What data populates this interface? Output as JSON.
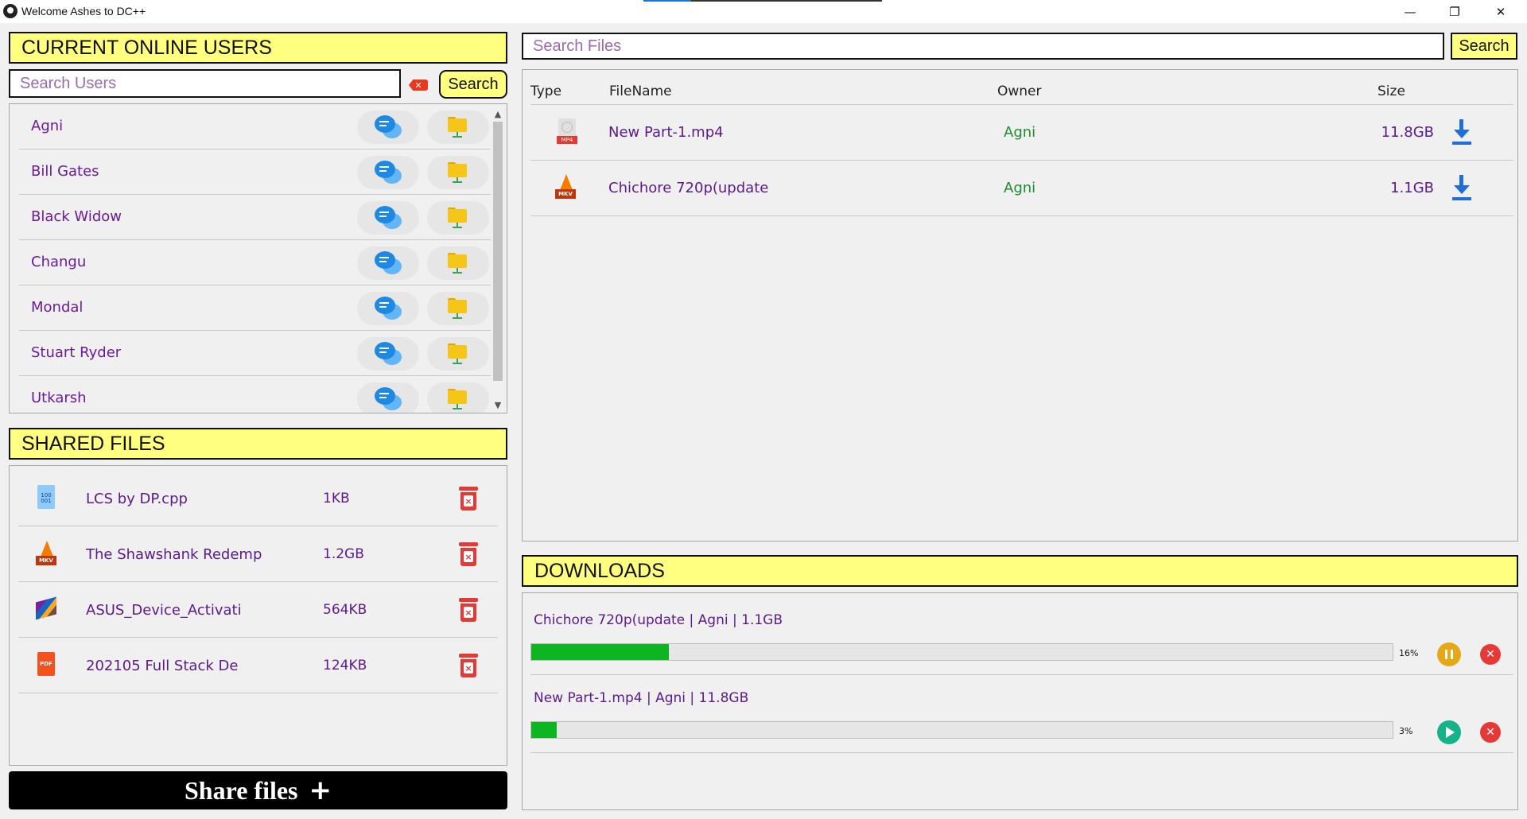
{
  "window": {
    "title": "Welcome Ashes to DC++",
    "minimize_glyph": "—",
    "restore_glyph": "❐",
    "close_glyph": "✕"
  },
  "users": {
    "header": "CURRENT ONLINE USERS",
    "search_placeholder": "Search Users",
    "clear_glyph": "✕",
    "search_button": "Search",
    "list": [
      {
        "name": "Agni"
      },
      {
        "name": "Bill Gates"
      },
      {
        "name": "Black Widow"
      },
      {
        "name": "Changu"
      },
      {
        "name": "Mondal"
      },
      {
        "name": "Stuart Ryder"
      },
      {
        "name": "Utkarsh"
      }
    ]
  },
  "shared": {
    "header": "SHARED FILES",
    "files": [
      {
        "name": "LCS by DP.cpp",
        "size": "1KB",
        "icon": "binary-file-icon",
        "badge": "100\n001"
      },
      {
        "name": "The Shawshank Redemp",
        "size": "1.2GB",
        "icon": "mkv-file-icon",
        "badge": "MKV"
      },
      {
        "name": "ASUS_Device_Activati",
        "size": "564KB",
        "icon": "archive-file-icon",
        "badge": ""
      },
      {
        "name": "202105 Full Stack De",
        "size": "124KB",
        "icon": "pdf-file-icon",
        "badge": "PDF"
      }
    ],
    "share_button": "Share files",
    "share_plus": "+"
  },
  "search": {
    "placeholder": "Search Files",
    "button": "Search",
    "columns": {
      "type": "Type",
      "filename": "FileName",
      "owner": "Owner",
      "size": "Size"
    },
    "results": [
      {
        "name": "New Part-1.mp4",
        "owner": "Agni",
        "size": "11.8GB",
        "icon": "mp4-file-icon",
        "badge": "MP4"
      },
      {
        "name": "Chichore 720p(update",
        "owner": "Agni",
        "size": "1.1GB",
        "icon": "mkv-file-icon",
        "badge": "MKV"
      }
    ]
  },
  "downloads": {
    "header": "DOWNLOADS",
    "items": [
      {
        "info": "Chichore 720p(update | Agni | 1.1GB",
        "percent_label": "16%",
        "progress": 0.16,
        "state": "downloading",
        "action_icon": "pause-icon"
      },
      {
        "info": "New Part-1.mp4 | Agni | 11.8GB",
        "percent_label": "3%",
        "progress": 0.03,
        "state": "paused",
        "action_icon": "play-icon"
      }
    ]
  },
  "colors": {
    "header_yellow": "#ffff80",
    "accent_purple": "#5b1a8b",
    "owner_green": "#1e8c2e",
    "progress_green": "#0db520",
    "download_blue": "#1e6fd9",
    "delete_red": "#e53935"
  }
}
